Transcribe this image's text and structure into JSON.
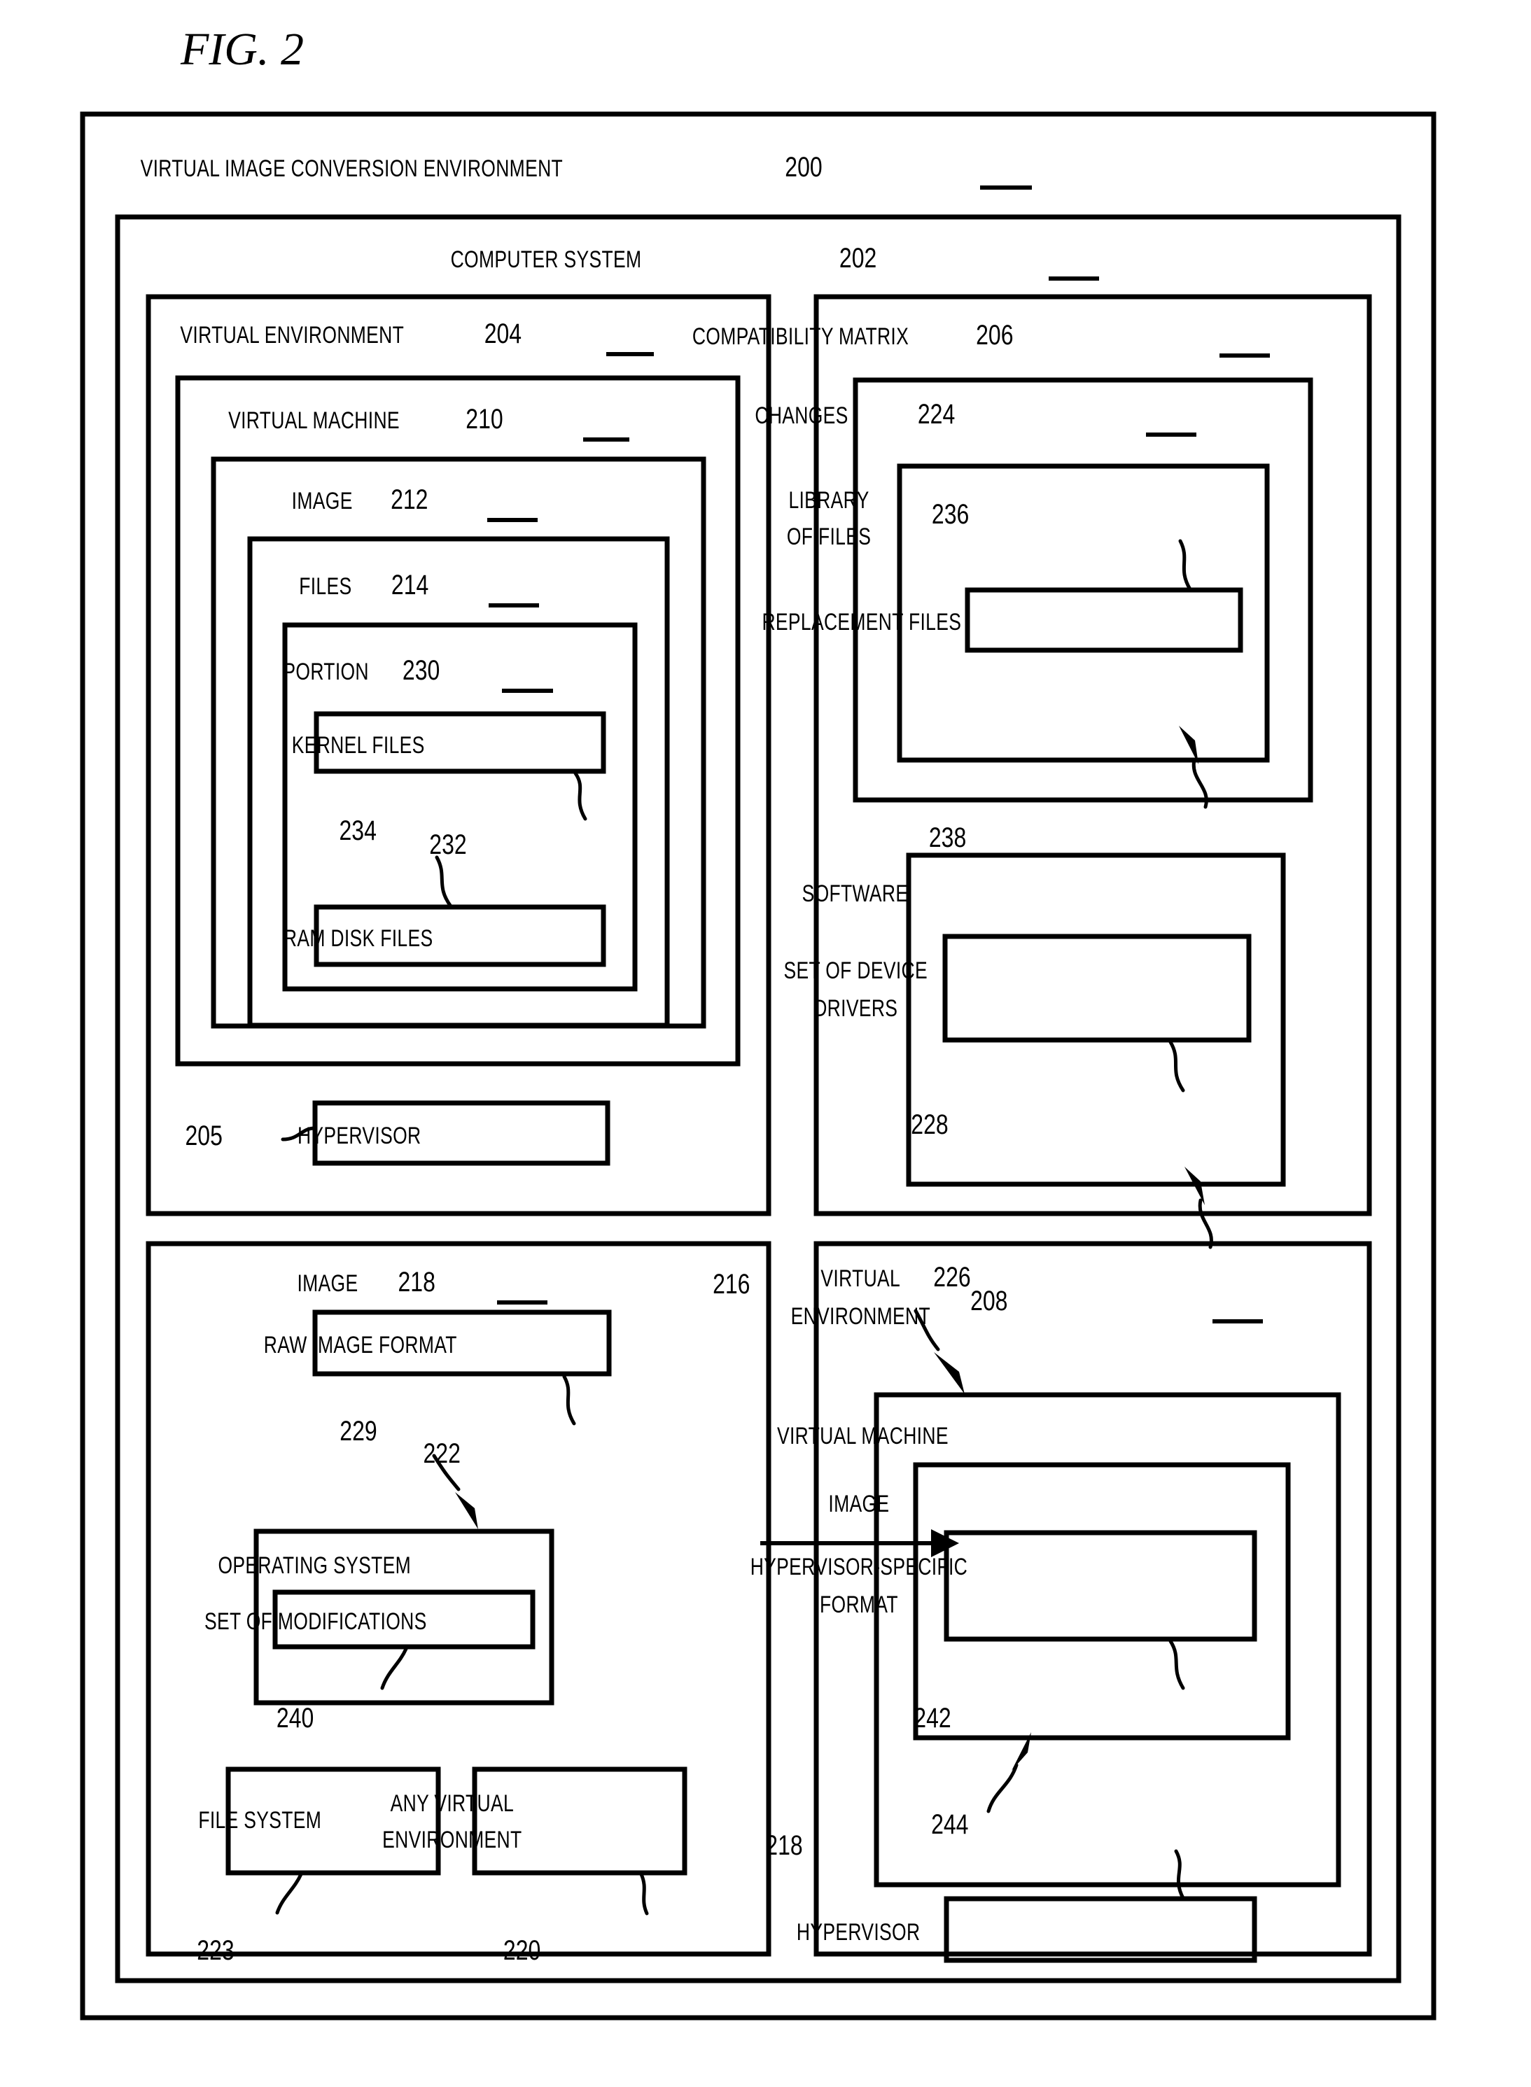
{
  "figure": {
    "title": "FIG. 2",
    "root_label": "VIRTUAL IMAGE CONVERSION ENVIRONMENT",
    "root_ref": "200"
  },
  "computer_system": {
    "label": "COMPUTER SYSTEM",
    "ref": "202"
  },
  "panels": {
    "virtual_environment_204": {
      "label": "VIRTUAL ENVIRONMENT",
      "ref": "204",
      "virtual_machine": {
        "label": "VIRTUAL MACHINE",
        "ref": "210"
      },
      "image": {
        "label": "IMAGE",
        "ref": "212"
      },
      "files": {
        "label": "FILES",
        "ref": "214"
      },
      "portion": {
        "label": "PORTION",
        "ref": "230"
      },
      "kernel_files": {
        "label": "KERNEL FILES",
        "ref": "232"
      },
      "ram_disk_files": {
        "label": "RAM DISK FILES",
        "ref": "234"
      },
      "hypervisor": {
        "label": "HYPERVISOR",
        "ref": "205"
      }
    },
    "compatibility_matrix_206": {
      "label": "COMPATIBILITY MATRIX",
      "ref": "206",
      "changes": {
        "label": "CHANGES",
        "ref": "224"
      },
      "library_of_files": {
        "line1": "LIBRARY",
        "line2": "OF FILES",
        "ref": "236"
      },
      "replacement_files": {
        "label": "REPLACEMENT FILES",
        "ref": "238"
      },
      "software": {
        "label": "SOFTWARE",
        "ref": "226"
      },
      "set_of_device_drivers": {
        "line1": "SET OF DEVICE",
        "line2": "DRIVERS",
        "ref": "228"
      }
    },
    "image_218": {
      "label": "IMAGE",
      "ref": "218",
      "raw_image_format": {
        "label": "RAW IMAGE FORMAT",
        "ref": "222"
      },
      "operating_system": {
        "label": "OPERATING SYSTEM",
        "ref": "229"
      },
      "set_of_modifications": {
        "label": "SET OF MODIFICATIONS",
        "ref": "240"
      },
      "file_system": {
        "label": "FILE SYSTEM",
        "ref": "223"
      },
      "any_virtual_environment": {
        "line1": "ANY VIRTUAL",
        "line2": "ENVIRONMENT",
        "ref": "220"
      }
    },
    "virtual_environment_208": {
      "line1": "VIRTUAL",
      "line2": "ENVIRONMENT",
      "ref": "208",
      "pointer_ref": "216",
      "virtual_machine": {
        "label": "VIRTUAL MACHINE"
      },
      "image": {
        "label": "IMAGE",
        "ref": "218"
      },
      "hypervisor_specific_format": {
        "line1": "HYPERVISOR-SPECIFIC",
        "line2": "FORMAT",
        "ref": "242"
      },
      "hypervisor": {
        "label": "HYPERVISOR",
        "ref": "244"
      }
    }
  },
  "colors": {
    "line": "#000000",
    "background": "#ffffff"
  }
}
